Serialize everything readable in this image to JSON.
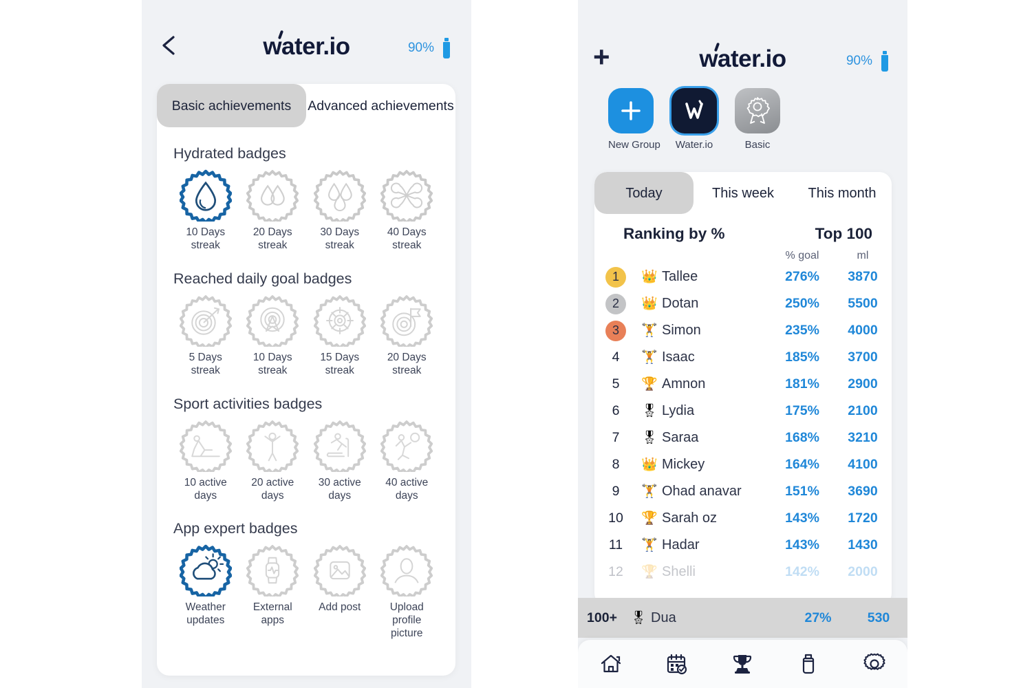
{
  "brand": {
    "name": "water.io",
    "accent": "#1f87d8",
    "dark": "#121a38"
  },
  "left_phone": {
    "header": {
      "back_icon": "chevron-left-icon",
      "logo": "water.io",
      "battery_pct": "90%",
      "battery_icon": "bottle-icon"
    },
    "tabs": [
      {
        "label": "Basic achievements",
        "active": true
      },
      {
        "label": "Advanced achievements",
        "active": false
      }
    ],
    "sections": [
      {
        "title": "Hydrated badges",
        "badges": [
          {
            "label": "10 Days\nstreak",
            "icon": "water-drop-badge",
            "earned": true
          },
          {
            "label": "20 Days\nstreak",
            "icon": "two-drops-badge",
            "earned": false
          },
          {
            "label": "30 Days\nstreak",
            "icon": "three-drops-badge",
            "earned": false
          },
          {
            "label": "40 Days\nstreak",
            "icon": "four-drops-badge",
            "earned": false
          }
        ]
      },
      {
        "title": "Reached daily goal badges",
        "badges": [
          {
            "label": "5 Days\nstreak",
            "icon": "target-dart-badge",
            "earned": false
          },
          {
            "label": "10 Days\nstreak",
            "icon": "target-arrow-up-badge",
            "earned": false
          },
          {
            "label": "15 Days\nstreak",
            "icon": "crosshair-badge",
            "earned": false
          },
          {
            "label": "20 Days\nstreak",
            "icon": "target-flag-badge",
            "earned": false
          }
        ]
      },
      {
        "title": "Sport activities badges",
        "badges": [
          {
            "label": "10 active\ndays",
            "icon": "situp-badge",
            "earned": false
          },
          {
            "label": "20 active\ndays",
            "icon": "stretching-badge",
            "earned": false
          },
          {
            "label": "30 active\ndays",
            "icon": "treadmill-badge",
            "earned": false
          },
          {
            "label": "40 active\ndays",
            "icon": "basketball-badge",
            "earned": false
          }
        ]
      },
      {
        "title": "App expert badges",
        "badges": [
          {
            "label": "Weather\nupdates",
            "icon": "weather-cloud-sun-badge",
            "earned": true
          },
          {
            "label": "External\napps",
            "icon": "smartwatch-badge",
            "earned": false
          },
          {
            "label": "Add post",
            "icon": "image-badge",
            "earned": false
          },
          {
            "label": "Upload\nprofile\npicture",
            "icon": "avatar-badge",
            "earned": false
          }
        ]
      }
    ]
  },
  "right_phone": {
    "header": {
      "add_icon": "plus-icon",
      "logo": "water.io",
      "battery_pct": "90%",
      "battery_icon": "bottle-icon"
    },
    "groups": [
      {
        "label": "New Group",
        "icon": "plus-icon",
        "style": "new"
      },
      {
        "label": "Water.io",
        "icon": "water-io-logo-icon",
        "style": "wio",
        "selected": true
      },
      {
        "label": "Basic",
        "icon": "ribbon-rosette-icon",
        "style": "basic"
      }
    ],
    "leaderboard": {
      "tabs": [
        {
          "label": "Today",
          "active": true
        },
        {
          "label": "This week",
          "active": false
        },
        {
          "label": "This month",
          "active": false
        }
      ],
      "heading_left": "Ranking by %",
      "heading_right": "Top 100",
      "columns": {
        "goal": "% goal",
        "ml": "ml"
      },
      "rows": [
        {
          "rank": "1",
          "medal": "gold",
          "emoji": "crown-icon",
          "name": "Tallee",
          "goal": "276%",
          "ml": "3870"
        },
        {
          "rank": "2",
          "medal": "silver",
          "emoji": "crown-icon",
          "name": "Dotan",
          "goal": "250%",
          "ml": "5500"
        },
        {
          "rank": "3",
          "medal": "bronze",
          "emoji": "medal-icon",
          "name": "Simon",
          "goal": "235%",
          "ml": "4000"
        },
        {
          "rank": "4",
          "medal": "",
          "emoji": "medal-icon",
          "name": "Isaac",
          "goal": "185%",
          "ml": "3700"
        },
        {
          "rank": "5",
          "medal": "",
          "emoji": "trophy-icon",
          "name": "Amnon",
          "goal": "181%",
          "ml": "2900"
        },
        {
          "rank": "6",
          "medal": "",
          "emoji": "rosette-icon",
          "name": "Lydia",
          "goal": "175%",
          "ml": "2100"
        },
        {
          "rank": "7",
          "medal": "",
          "emoji": "rosette-icon",
          "name": "Saraa",
          "goal": "168%",
          "ml": "3210"
        },
        {
          "rank": "8",
          "medal": "",
          "emoji": "crown-icon",
          "name": "Mickey",
          "goal": "164%",
          "ml": "4100"
        },
        {
          "rank": "9",
          "medal": "",
          "emoji": "medal-icon",
          "name": "Ohad anavar",
          "goal": "151%",
          "ml": "3690"
        },
        {
          "rank": "10",
          "medal": "",
          "emoji": "trophy-icon",
          "name": "Sarah oz",
          "goal": "143%",
          "ml": "1720"
        },
        {
          "rank": "11",
          "medal": "",
          "emoji": "medal-icon",
          "name": "Hadar",
          "goal": "143%",
          "ml": "1430"
        },
        {
          "rank": "12",
          "medal": "",
          "emoji": "trophy-icon",
          "name": "Shelli",
          "goal": "142%",
          "ml": "2000"
        }
      ],
      "me_row": {
        "rank": "100+",
        "emoji": "rosette-icon",
        "name": "Dua",
        "goal": "27%",
        "ml": "530"
      }
    },
    "bottom_nav": [
      {
        "icon": "home-icon",
        "active": false
      },
      {
        "icon": "calendar-check-icon",
        "active": false
      },
      {
        "icon": "trophy-icon",
        "active": true
      },
      {
        "icon": "bottle-icon",
        "active": false
      },
      {
        "icon": "gear-icon",
        "active": false
      }
    ]
  }
}
